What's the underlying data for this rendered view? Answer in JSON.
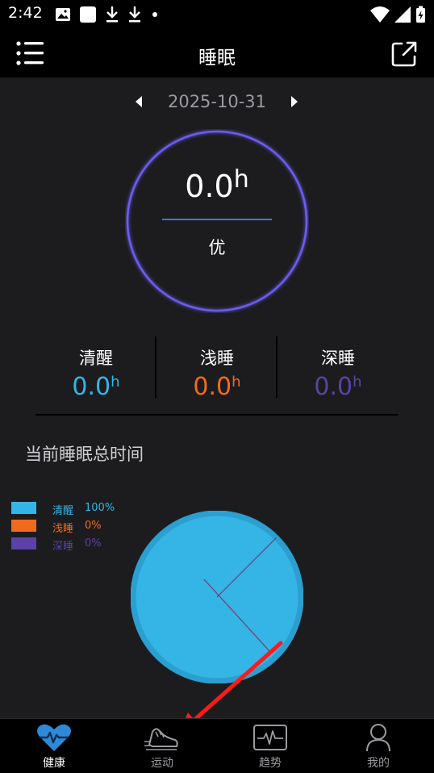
{
  "status_bar": {
    "time": "2:42",
    "icons_left": [
      "image-icon",
      "app-icon",
      "download-icon",
      "download-icon",
      "dot-icon"
    ],
    "icons_right": [
      "wifi-icon",
      "signal-icon",
      "battery-charging-icon"
    ]
  },
  "header": {
    "title": "睡眠",
    "menu_icon": "menu-icon",
    "share_icon": "share-icon"
  },
  "date_nav": {
    "date": "2025-10-31"
  },
  "summary": {
    "total_value": "0.0",
    "unit": "h",
    "grade": "优",
    "ring_color": "#6a5cf0"
  },
  "stats": [
    {
      "label": "清醒",
      "value": "0.0",
      "unit": "h",
      "color": "#35b4e6"
    },
    {
      "label": "浅睡",
      "value": "0.0",
      "unit": "h",
      "color": "#f26a1d"
    },
    {
      "label": "深睡",
      "value": "0.0",
      "unit": "h",
      "color": "#5a42a6"
    }
  ],
  "section": {
    "title": "当前睡眠总时间"
  },
  "chart_data": {
    "type": "pie",
    "categories": [
      "清醒",
      "浅睡",
      "深睡"
    ],
    "values": [
      100,
      0,
      0
    ],
    "value_labels": [
      "100%",
      "0%",
      "0%"
    ],
    "colors": [
      "#35b4e6",
      "#f26a1d",
      "#5a42a6"
    ],
    "legend_position": "top-left"
  },
  "annotation": {
    "arrow_color": "#ff1a1a"
  },
  "tabs": [
    {
      "label": "健康",
      "icon": "heart-pulse-icon",
      "active": true
    },
    {
      "label": "运动",
      "icon": "shoe-icon",
      "active": false
    },
    {
      "label": "趋势",
      "icon": "trend-chart-icon",
      "active": false
    },
    {
      "label": "我的",
      "icon": "user-icon",
      "active": false
    }
  ]
}
